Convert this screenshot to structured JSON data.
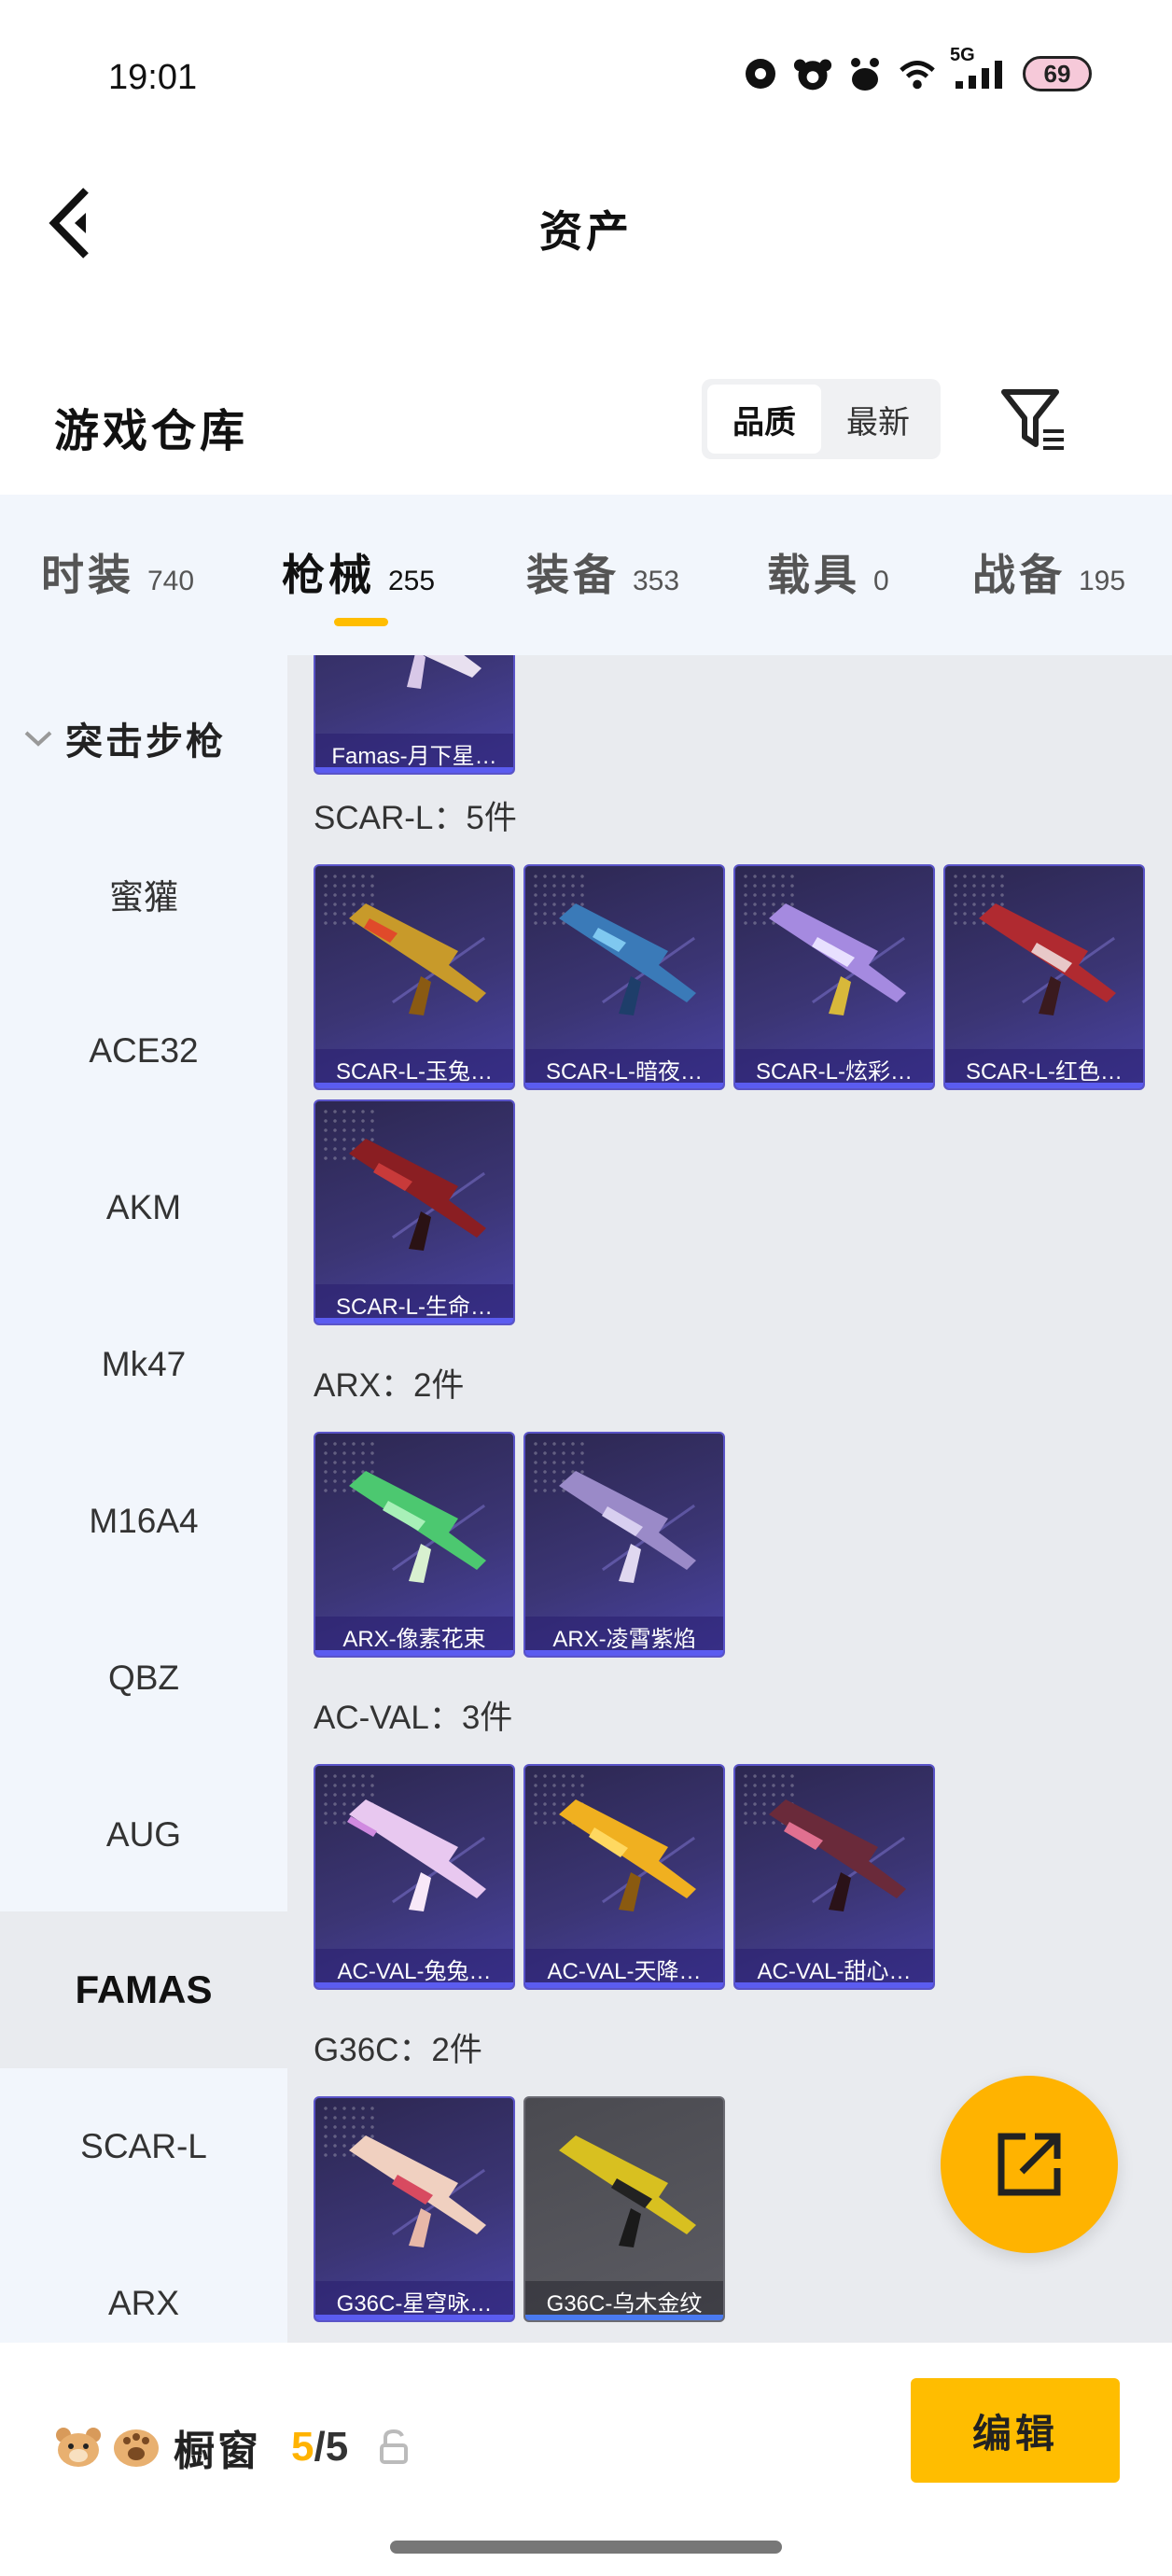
{
  "status_bar": {
    "time": "19:01",
    "network": "5G",
    "battery": "69"
  },
  "header": {
    "title": "资产"
  },
  "warehouse": {
    "title": "游戏仓库",
    "sort_options": [
      "品质",
      "最新"
    ],
    "active_sort": "品质"
  },
  "categories": [
    {
      "name": "时装",
      "count": "740"
    },
    {
      "name": "枪械",
      "count": "255",
      "active": true
    },
    {
      "name": "装备",
      "count": "353"
    },
    {
      "name": "载具",
      "count": "0"
    },
    {
      "name": "战备",
      "count": "195"
    }
  ],
  "sidebar": {
    "group": "突击步枪",
    "items": [
      "蜜獾",
      "ACE32",
      "AKM",
      "Mk47",
      "M16A4",
      "QBZ",
      "AUG",
      "FAMAS",
      "SCAR-L",
      "ARX"
    ],
    "active": "FAMAS"
  },
  "content": {
    "top_partial": {
      "name": "Famas-月下星…"
    },
    "groups": [
      {
        "label": "SCAR-L：5件",
        "items": [
          "SCAR-L-玉兔…",
          "SCAR-L-暗夜…",
          "SCAR-L-炫彩…",
          "SCAR-L-红色…",
          "SCAR-L-生命…"
        ]
      },
      {
        "label": "ARX：2件",
        "items": [
          "ARX-像素花束",
          "ARX-凌霄紫焰"
        ]
      },
      {
        "label": "AC-VAL：3件",
        "items": [
          "AC-VAL-兔兔…",
          "AC-VAL-天降…",
          "AC-VAL-甜心…"
        ]
      },
      {
        "label": "G36C：2件",
        "items": [
          "G36C-星穹咏…",
          "G36C-乌木金纹"
        ]
      }
    ]
  },
  "bottom_bar": {
    "label": "橱窗",
    "count_current": "5",
    "count_total": "/5",
    "edit_label": "编辑"
  },
  "colors": {
    "accent": "#ffbd00",
    "card_purple": "#3b3574",
    "rarity": "#5b5cf0"
  }
}
